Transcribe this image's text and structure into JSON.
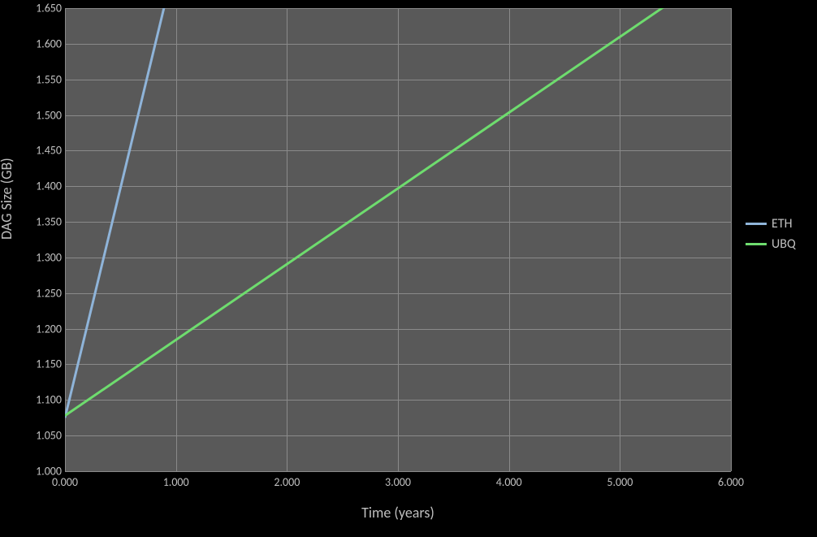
{
  "chart_data": {
    "type": "line",
    "xlabel": "Time (years)",
    "ylabel": "DAG Size (GB)",
    "xlim": [
      0.0,
      6.0
    ],
    "ylim": [
      1.0,
      1.65
    ],
    "x_ticks": [
      0.0,
      1.0,
      2.0,
      3.0,
      4.0,
      5.0,
      6.0
    ],
    "y_ticks": [
      1.0,
      1.05,
      1.1,
      1.15,
      1.2,
      1.25,
      1.3,
      1.35,
      1.4,
      1.45,
      1.5,
      1.55,
      1.6,
      1.65
    ],
    "x_tick_labels": [
      "0.000",
      "1.000",
      "2.000",
      "3.000",
      "4.000",
      "5.000",
      "6.000"
    ],
    "y_tick_labels": [
      "1.000",
      "1.050",
      "1.100",
      "1.150",
      "1.200",
      "1.250",
      "1.300",
      "1.350",
      "1.400",
      "1.450",
      "1.500",
      "1.550",
      "1.600",
      "1.650"
    ],
    "series": [
      {
        "name": "ETH",
        "color": "#8fb4d9",
        "x": [
          0.0,
          1.0
        ],
        "y": [
          1.075,
          1.72
        ]
      },
      {
        "name": "UBQ",
        "color": "#6edc6e",
        "x": [
          0.0,
          6.0
        ],
        "y": [
          1.078,
          1.716
        ]
      }
    ],
    "legend_position": "right",
    "grid": true,
    "background": "#595959"
  },
  "y_axis_title_offset_fix": "DAG Size (GB)"
}
